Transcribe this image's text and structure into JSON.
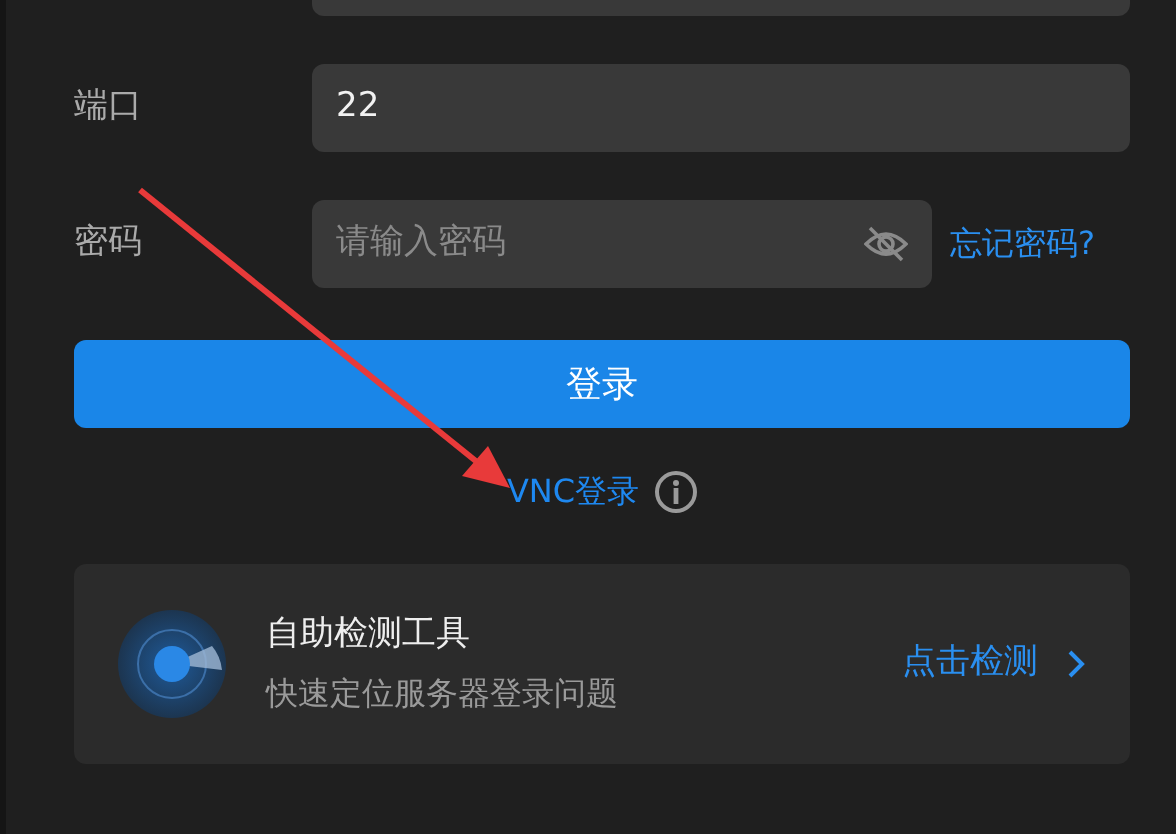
{
  "fields": [
    {
      "kind": "text",
      "label": "端口",
      "value": "22"
    },
    {
      "kind": "password",
      "label": "密码",
      "placeholder": "请输入密码",
      "link": "忘记密码?"
    }
  ],
  "login_button": "登录",
  "vnc_link": "VNC登录",
  "tool_card": {
    "title": "自助检测工具",
    "subtitle": "快速定位服务器登录问题",
    "action": "点击检测"
  }
}
